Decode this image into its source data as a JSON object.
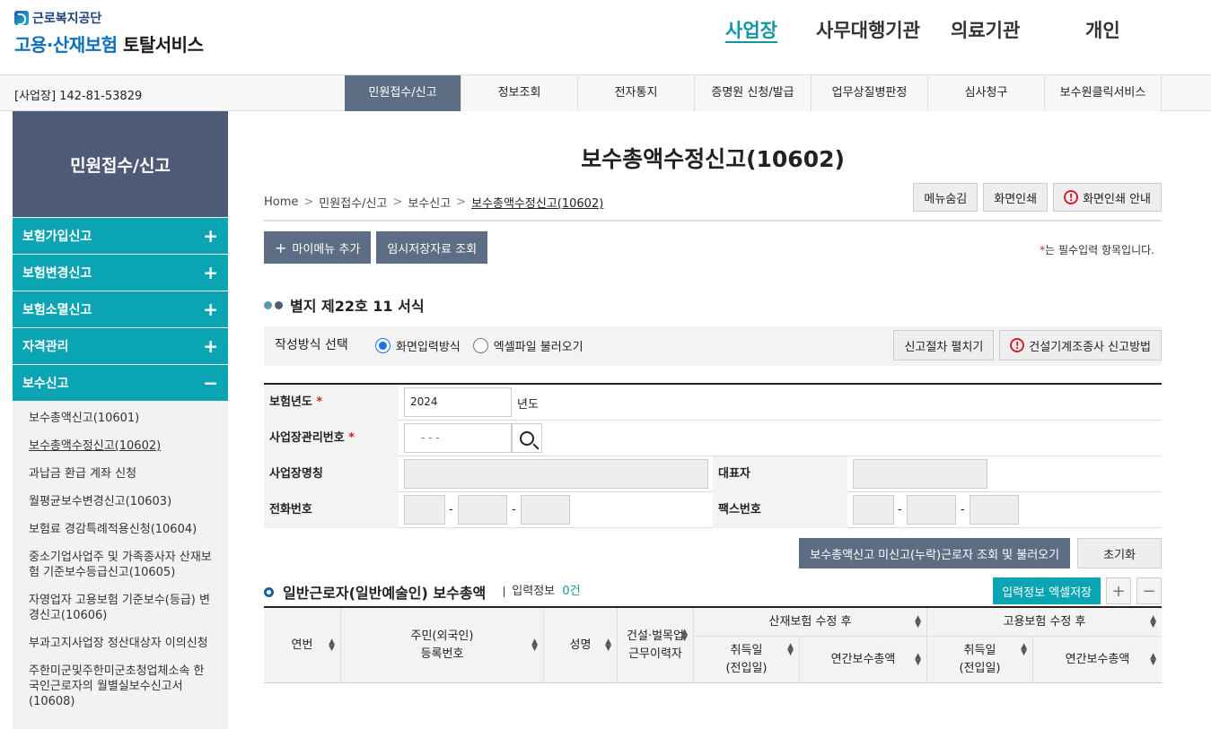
{
  "header": {
    "org_name": "근로복지공단",
    "service_name_blue": "고용·산재보험",
    "service_name_dark": "토탈서비스",
    "nav": [
      "사업장",
      "사무대행기관",
      "의료기관",
      "개인"
    ]
  },
  "subbar": {
    "business_id": "[사업장] 142-81-53829",
    "tabs": [
      "민원접수/신고",
      "정보조회",
      "전자통지",
      "증명원 신청/발급",
      "업무상질병판정",
      "심사청구",
      "보수원클릭서비스"
    ]
  },
  "sidebar": {
    "title": "민원접수/신고",
    "categories": [
      {
        "label": "보험가입신고",
        "sign": "+"
      },
      {
        "label": "보험변경신고",
        "sign": "+"
      },
      {
        "label": "보험소멸신고",
        "sign": "+"
      },
      {
        "label": "자격관리",
        "sign": "+"
      },
      {
        "label": "보수신고",
        "sign": "−"
      }
    ],
    "items": [
      "보수총액신고(10601)",
      "보수총액수정신고(10602)",
      "과납금 환급 계좌 신청",
      "월평균보수변경신고(10603)",
      "보험료 경감특례적용신청(10604)",
      "중소기업사업주 및 가족종사자 산재보험 기준보수등급신고(10605)",
      "자영업자 고용보험 기준보수(등급) 변경신고(10606)",
      "부과고지사업장 정산대상자 이의신청",
      "주한미군및주한미군초청업체소속 한국인근로자의 월별실보수신고서(10608)"
    ]
  },
  "main": {
    "title": "보수총액수정신고(10602)",
    "breadcrumb": [
      "Home",
      "민원접수/신고",
      "보수신고",
      "보수총액수정신고(10602)"
    ],
    "util_buttons": {
      "hide_menu": "메뉴숨김",
      "print": "화면인쇄",
      "print_guide": "화면인쇄 안내"
    },
    "add_mymenu": "마이메뉴 추가",
    "temp_lookup": "임시저장자료 조회",
    "required_note_star": "*",
    "required_note": "는 필수입력 항목입니다.",
    "section_title": "별지 제22호 11 서식",
    "method": {
      "label": "작성방식 선택",
      "option1": "화면입력방식",
      "option2": "엑셀파일 불러오기",
      "expand_btn": "신고절차 펼치기",
      "construction_btn": "건설기계조종사 신고방법"
    },
    "form": {
      "year_label": "보험년도",
      "year_value": "2024",
      "year_suffix": "년도",
      "mgmt_label": "사업장관리번호",
      "mgmt_placeholder": "- - -",
      "name_label": "사업장명칭",
      "rep_label": "대표자",
      "phone_label": "전화번호",
      "fax_label": "팩스번호",
      "dash": "-",
      "star": "*"
    },
    "lookup_btn": "보수총액신고 미신고(누락)근로자 조회 및 불러오기",
    "reset_btn": "초기화",
    "section2": {
      "title": "일반근로자(일반예술인) 보수총액",
      "info_label": "입력정보",
      "count": "0건",
      "excel_btn": "입력정보 엑셀저장",
      "plus": "+",
      "minus": "−"
    },
    "table_headers": {
      "seq": "연번",
      "rrn": "주민(외국인)\n등록번호",
      "name": "성명",
      "construction": "건설·벌목업\n근무이력자",
      "indus_group": "산재보험 수정 후",
      "indus_acq": "취득일\n(전입일)",
      "indus_total": "연간보수총액",
      "emp_group": "고용보험 수정 후",
      "emp_acq": "취득일\n(전입일)",
      "emp_total": "연간보수총액"
    }
  },
  "colors": {
    "teal": "#0ba4b3",
    "slate": "#5d6e84",
    "sidebar_header": "#4f5a76",
    "nav_active": "#1296a6"
  }
}
